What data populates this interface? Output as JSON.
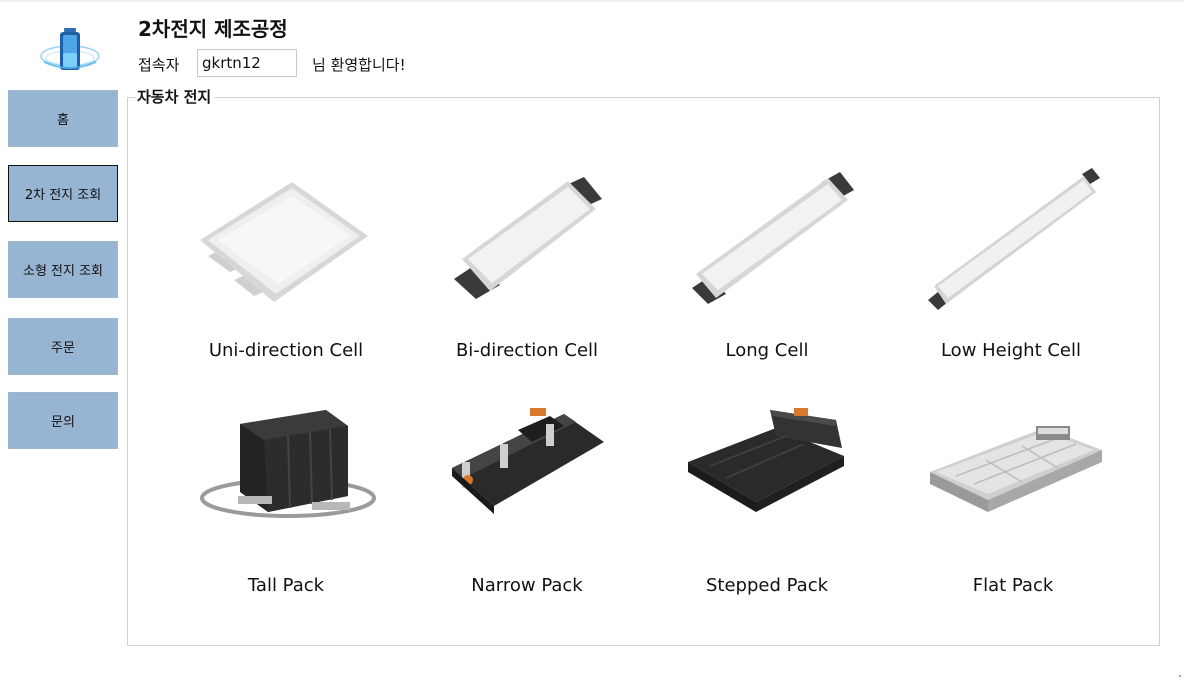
{
  "header": {
    "title": "2차전지 제조공정",
    "user_label": "접속자",
    "username": "gkrtn12",
    "welcome": "님 환영합니다!"
  },
  "sidebar": {
    "items": [
      {
        "label": "홈",
        "active": false
      },
      {
        "label": "2차 전지 조회",
        "active": true
      },
      {
        "label": "소형 전지 조회",
        "active": false
      },
      {
        "label": "주문",
        "active": false
      },
      {
        "label": "문의",
        "active": false
      }
    ]
  },
  "main": {
    "group_title": "자동차 전지",
    "products": [
      {
        "label": "Uni-direction Cell"
      },
      {
        "label": "Bi-direction Cell"
      },
      {
        "label": "Long Cell"
      },
      {
        "label": "Low Height Cell"
      },
      {
        "label": "Tall Pack"
      },
      {
        "label": "Narrow Pack"
      },
      {
        "label": "Stepped Pack"
      },
      {
        "label": "Flat Pack"
      }
    ]
  },
  "colors": {
    "sidebar_button": "#98b4d3",
    "active_border": "#111111",
    "cell_silver": "#e6e6e6",
    "tab_dark": "#3a3a3a",
    "pack_black": "#262626",
    "connector_orange": "#d9772a"
  },
  "icons": {
    "logo": "battery-logo-icon"
  }
}
